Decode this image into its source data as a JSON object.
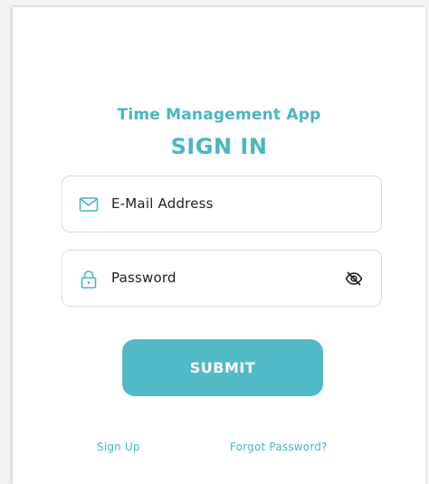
{
  "app": {
    "title": "Time Management App",
    "heading": "SIGN IN"
  },
  "form": {
    "email_placeholder": "E-Mail Address",
    "password_placeholder": "Password",
    "email_icon": "mail-icon",
    "password_icon": "lock-icon",
    "visibility_icon": "eye-off-icon",
    "submit_label": "SUBMIT"
  },
  "links": {
    "sign_up": "Sign Up",
    "forgot_password": "Forgot Password?"
  },
  "colors": {
    "accent": "#52bac6",
    "text": "#1f1f1f",
    "border": "#dcdcdc"
  }
}
